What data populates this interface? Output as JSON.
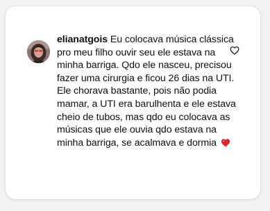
{
  "comment": {
    "username": "elianatgois",
    "text": "Eu colocava música clássica pro meu filho ouvir seu ele estava na minha barriga. Qdo ele nasceu, precisou fazer uma cirurgia e ficou 26 dias na UTI. Ele chorava bastante, pois não podia mamar, a UTI era barulhenta e ele estava cheio de tubos, mas qdo eu colocava as músicas que ele ouvia qdo estava na minha barriga, se acalmava e dormia",
    "emoji": "red-heart-icon"
  },
  "like_icon": "heart-outline-icon",
  "colors": {
    "card_background": "#ffffff",
    "page_background": "#f2f2f2",
    "text": "#111111",
    "heart_emoji": "#e0242e"
  }
}
